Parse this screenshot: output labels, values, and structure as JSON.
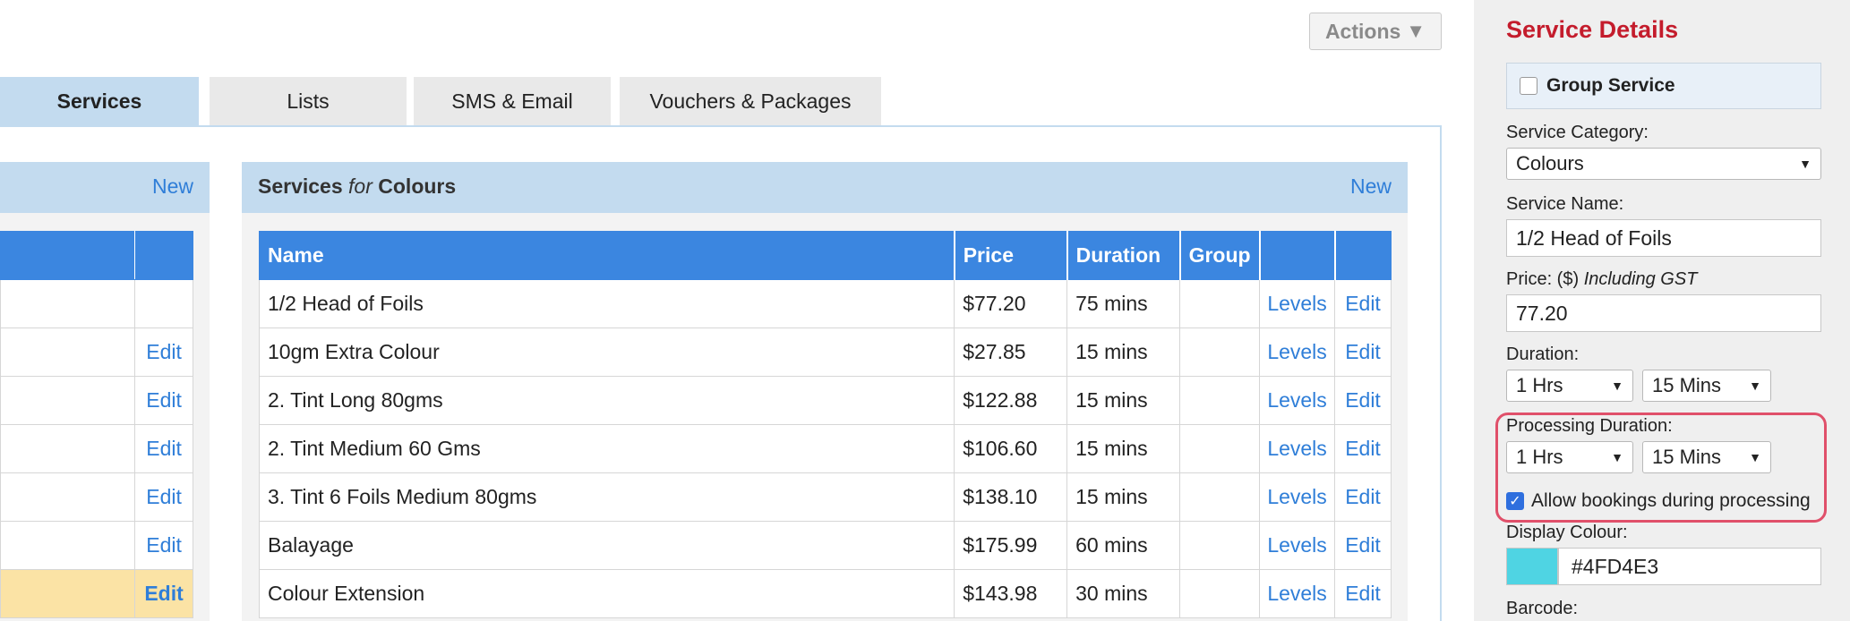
{
  "toolbar": {
    "actions_label": "Actions"
  },
  "tabs": [
    {
      "label": "Services",
      "active": true
    },
    {
      "label": "Lists",
      "active": false
    },
    {
      "label": "SMS & Email",
      "active": false
    },
    {
      "label": "Vouchers & Packages",
      "active": false
    }
  ],
  "categories_panel": {
    "new_label": "New",
    "rows": [
      {
        "edit": ""
      },
      {
        "edit": "Edit"
      },
      {
        "edit": "Edit"
      },
      {
        "edit": "Edit"
      },
      {
        "edit": "Edit"
      },
      {
        "edit": "Edit"
      },
      {
        "edit": "Edit",
        "highlighted": true
      }
    ]
  },
  "services_panel": {
    "title_prefix": "Services",
    "title_for": "for",
    "category": "Colours",
    "new_label": "New",
    "columns": [
      "Name",
      "Price",
      "Duration",
      "Group",
      "",
      ""
    ],
    "rows": [
      {
        "name": "1/2 Head of Foils",
        "price": "$77.20",
        "duration": "75 mins",
        "group": "",
        "levels": "Levels",
        "edit": "Edit"
      },
      {
        "name": "10gm Extra Colour",
        "price": "$27.85",
        "duration": "15 mins",
        "group": "",
        "levels": "Levels",
        "edit": "Edit"
      },
      {
        "name": "2. Tint Long 80gms",
        "price": "$122.88",
        "duration": "15 mins",
        "group": "",
        "levels": "Levels",
        "edit": "Edit"
      },
      {
        "name": "2. Tint Medium 60 Gms",
        "price": "$106.60",
        "duration": "15 mins",
        "group": "",
        "levels": "Levels",
        "edit": "Edit"
      },
      {
        "name": "3. Tint 6 Foils Medium 80gms",
        "price": "$138.10",
        "duration": "15 mins",
        "group": "",
        "levels": "Levels",
        "edit": "Edit"
      },
      {
        "name": "Balayage",
        "price": "$175.99",
        "duration": "60 mins",
        "group": "",
        "levels": "Levels",
        "edit": "Edit"
      },
      {
        "name": "Colour Extension",
        "price": "$143.98",
        "duration": "30 mins",
        "group": "",
        "levels": "Levels",
        "edit": "Edit"
      }
    ]
  },
  "service_details": {
    "title": "Service Details",
    "group_service_label": "Group Service",
    "group_service_checked": false,
    "category_label": "Service Category:",
    "category_value": "Colours",
    "name_label": "Service Name:",
    "name_value": "1/2 Head of Foils",
    "price_label": "Price: ($)",
    "price_note": "Including GST",
    "price_value": "77.20",
    "duration_label": "Duration:",
    "duration_hrs": "1 Hrs",
    "duration_mins": "15 Mins",
    "processing_label": "Processing Duration:",
    "processing_hrs": "1 Hrs",
    "processing_mins": "15 Mins",
    "allow_label": "Allow bookings during processing",
    "allow_checked": true,
    "display_colour_label": "Display Colour:",
    "display_colour_value": "#4FD4E3",
    "barcode_label": "Barcode:"
  },
  "colors": {
    "accent_blue": "#3b86e0",
    "panel_header": "#c3dbef",
    "title_red": "#c41c2c",
    "highlight_yellow": "#fbe3a5",
    "processing_border": "#e0506a"
  }
}
